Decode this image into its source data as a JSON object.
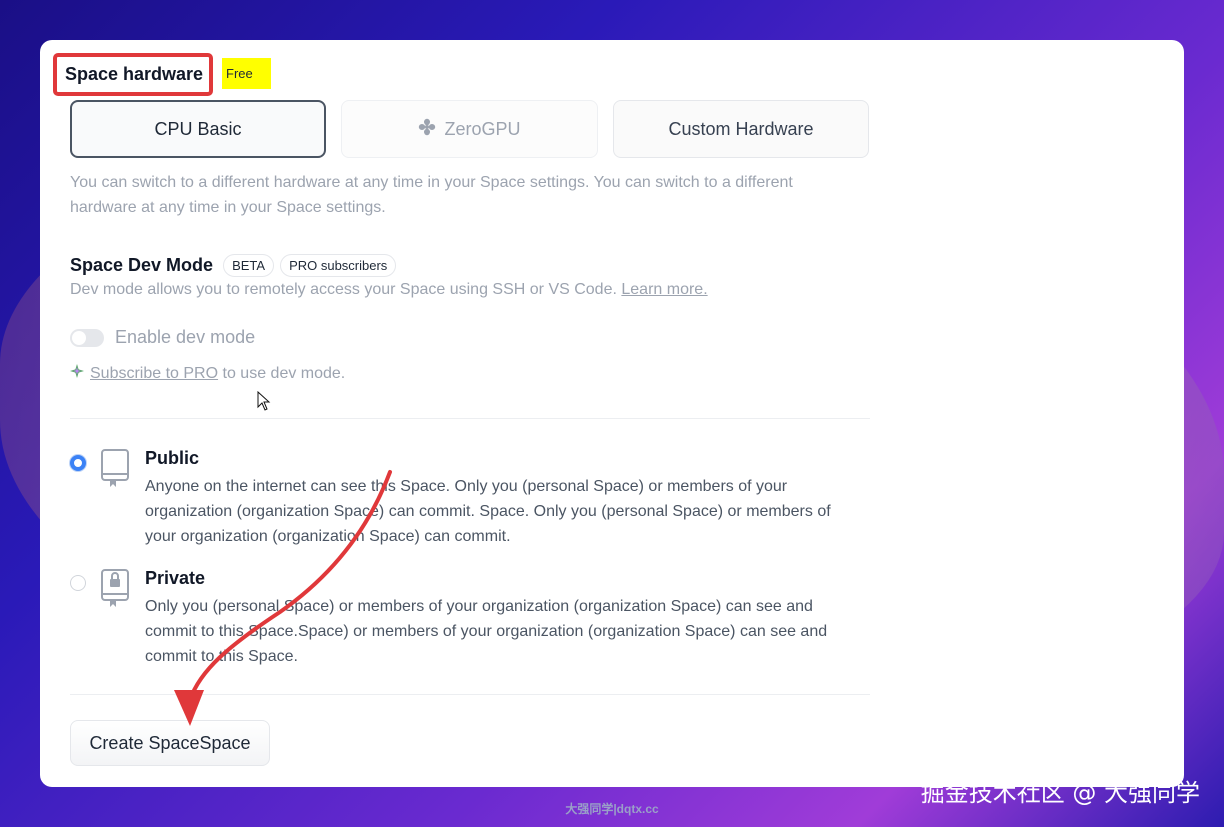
{
  "hardware": {
    "heading": "Space hardware",
    "badge": "Free",
    "options": [
      {
        "label": "CPU Basic",
        "state": "selected"
      },
      {
        "label": "ZeroGPU",
        "state": "disabled",
        "icon": "fan-icon"
      },
      {
        "label": "Custom Hardware",
        "state": "default"
      }
    ],
    "help": "You can switch to a different hardware at any time in your Space settings. You can switch to a different hardware at any time in your Space settings."
  },
  "dev_mode": {
    "title": "Space Dev Mode",
    "beta_pill": "BETA",
    "pro_pill": "PRO subscribers",
    "description": "Dev mode allows you to remotely access your Space using SSH or VS Code.",
    "learn_more": "Learn more.",
    "toggle_label": "Enable dev mode",
    "toggle_on": false,
    "subscribe_link": "Subscribe to PRO",
    "subscribe_rest": " to use dev mode."
  },
  "visibility": {
    "public": {
      "title": "Public",
      "description": "Anyone on the internet can see this Space. Only you (personal Space) or members of your organization (organization Space) can commit. Space. Only you (personal Space) or members of your organization (organization Space) can commit.",
      "selected": true
    },
    "private": {
      "title": "Private",
      "description": "Only you (personal Space) or members of your organization (organization Space) can see and commit to this Space.Space) or members of your organization (organization Space) can see and commit to this Space.",
      "selected": false
    }
  },
  "create_button": "Create SpaceSpace",
  "watermark": {
    "center": "大强同学|dqtx.cc",
    "right": "掘金技术社区 @ 大强同学"
  },
  "colors": {
    "highlight_box": "#e0383a",
    "badge_bg": "#ffff00",
    "radio_selected": "#3b82f6",
    "annotation_arrow": "#e0383a"
  }
}
